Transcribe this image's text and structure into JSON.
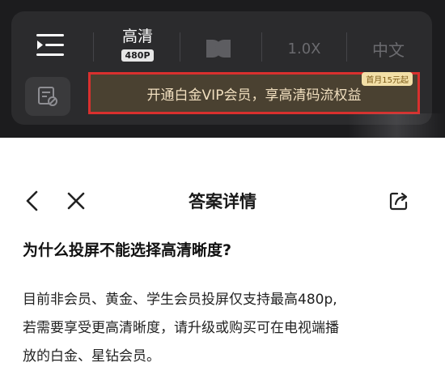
{
  "player": {
    "quality_label": "高清",
    "quality_badge": "480P",
    "speed_label": "1.0X",
    "language_label": "中文",
    "vip_banner_text": "开通白金VIP会员，享高清码流权益",
    "vip_tag": "首月15元起",
    "icons": [
      "playlist-icon",
      "dolby-icon",
      "subtitle-settings-icon"
    ]
  },
  "nav": {
    "title": "答案详情",
    "icons": [
      "back-icon",
      "close-icon",
      "share-icon"
    ]
  },
  "content": {
    "question": "为什么投屏不能选择高清晰度?",
    "answer_lines": [
      "目前非会员、黄金、学生会员投屏仅支持最高480p,",
      "若需要享受更高清晰度，请升级或购买可在电视端播",
      "放的白金、星钻会员。"
    ]
  },
  "colors": {
    "banner_border": "#d9302e",
    "banner_bg": "#4a4131",
    "banner_text": "#f1dfbf"
  }
}
